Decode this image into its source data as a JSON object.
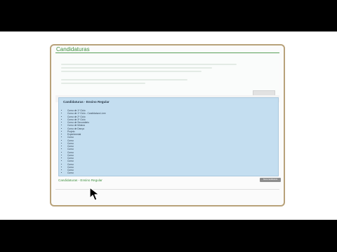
{
  "panel": {
    "title": "Candidaturas"
  },
  "info_box": {
    "title": "Candidaturas - Ensino Regular",
    "items": [
      "Curso de 1º Ciclo",
      "Curso de 1º Ciclo - Candidatura Livre",
      "Curso de 2º Ciclo",
      "Curso de 3º Ciclo",
      "Curso de Secundário",
      "Curso de Música",
      "Curso de Dança",
      "Projeto",
      "Experimental",
      "Curso",
      "Curso",
      "Curso",
      "Curso",
      "Curso",
      "Curso",
      "Curso",
      "Curso",
      "Curso",
      "Curso",
      "Curso",
      "Curso",
      "Curso"
    ]
  },
  "section2": {
    "title": "Candidaturas - Ensino Regular",
    "button_label": "Nova candidatura"
  }
}
